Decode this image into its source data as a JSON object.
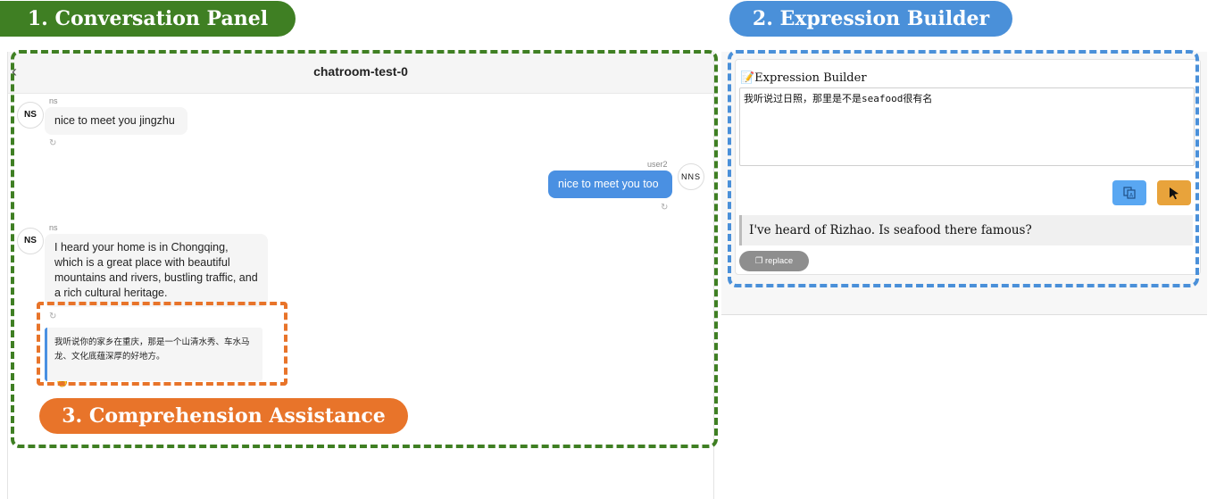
{
  "labels": {
    "conversation_panel": "1. Conversation Panel",
    "expression_builder": "2. Expression Builder",
    "comprehension_assistance": "3. Comprehension Assistance"
  },
  "chat": {
    "title": "chatroom-test-0",
    "messages": [
      {
        "sender": "ns",
        "avatar": "NS",
        "side": "left",
        "text": "nice to meet you jingzhu"
      },
      {
        "sender": "user2",
        "avatar": "NNS",
        "side": "right",
        "text": "nice to meet you too"
      },
      {
        "sender": "ns",
        "avatar": "NS",
        "side": "left",
        "text": "I heard your home is in Chongqing, which is a great place with beautiful mountains and rivers, bustling traffic, and a rich cultural heritage."
      }
    ],
    "translation": "我听说你的家乡在重庆，那是一个山清水秀、车水马龙、文化底蕴深厚的好地方。"
  },
  "expression_builder": {
    "heading": "📝Expression Builder",
    "input_value": "我听说过日照，那里是不是seafood很有名",
    "output": "I've heard of Rizhao. Is seafood there famous?",
    "replace_label": "replace"
  },
  "colors": {
    "green": "#3f7f23",
    "blue": "#4a90d9",
    "orange": "#e8742a",
    "bubble_right": "#4a90e2",
    "translate_button": "#59a7f2",
    "cursor_button": "#e8a33b"
  },
  "icons": [
    "back-icon",
    "refresh-icon",
    "hand-pointer-icon",
    "translate-icon",
    "cursor-icon",
    "copy-icon"
  ]
}
